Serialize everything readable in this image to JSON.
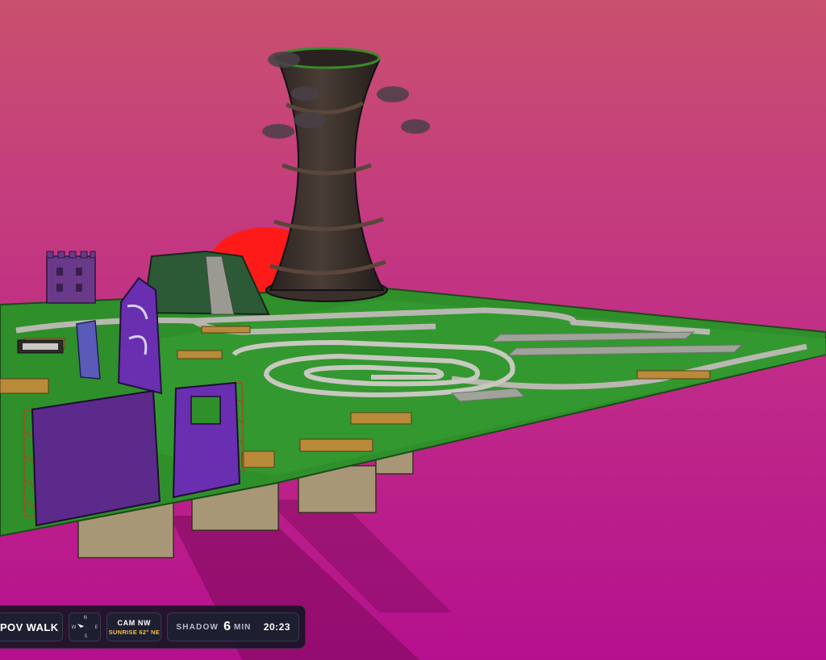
{
  "scene": {
    "sky_top": "#c9506f",
    "sky_bottom": "#b5108e",
    "ground_green": "#2f8f2a",
    "track_grey": "#b8b8b0",
    "tower_dark": "#3a2f2a",
    "sun_red": "#ff1a1a",
    "wall_purple": "#5b2a8a"
  },
  "hud": {
    "mode_label": "POV WALK",
    "compass": {
      "n": "N",
      "s": "S",
      "e": "E",
      "w": "W"
    },
    "camera_label": "CAM NW",
    "sun_label": "SUNRISE 62° NE",
    "shadow_label": "SHADOW",
    "shadow_value": "6",
    "shadow_unit": "MIN",
    "clock": "20:23"
  }
}
